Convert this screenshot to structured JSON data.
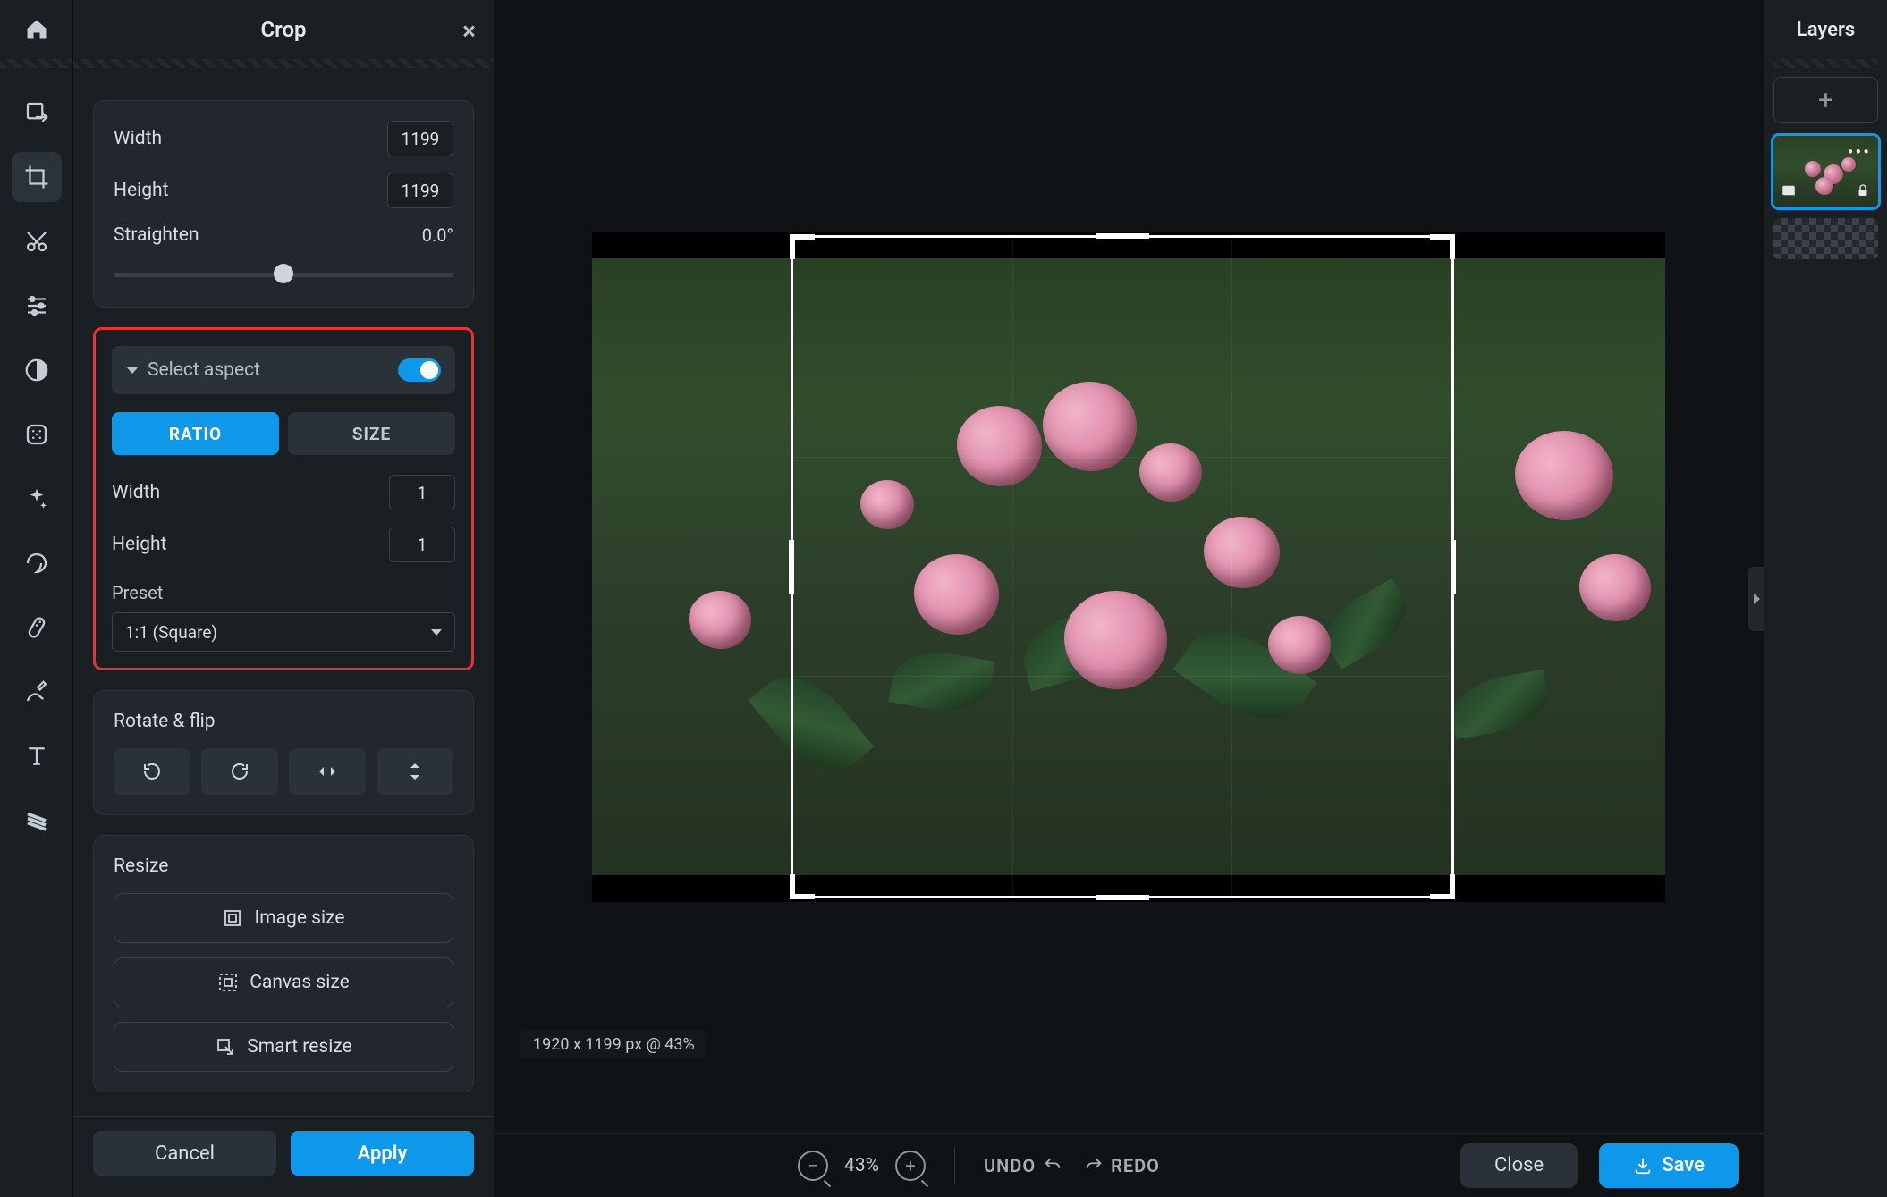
{
  "panel": {
    "title": "Crop",
    "width_label": "Width",
    "height_label": "Height",
    "straighten_label": "Straighten",
    "width_value": "1199",
    "height_value": "1199",
    "straighten_value": "0.0°",
    "aspect_heading": "Select aspect",
    "seg_ratio": "RATIO",
    "seg_size": "SIZE",
    "ratio_width_label": "Width",
    "ratio_height_label": "Height",
    "ratio_width_value": "1",
    "ratio_height_value": "1",
    "preset_label": "Preset",
    "preset_selected": "1:1 (Square)",
    "rotate_flip_title": "Rotate & flip",
    "resize_title": "Resize",
    "image_size_btn": "Image size",
    "canvas_size_btn": "Canvas size",
    "smart_resize_btn": "Smart resize",
    "cancel": "Cancel",
    "apply": "Apply"
  },
  "stage": {
    "dimensions_badge": "1920 x 1199 px @ 43%",
    "zoom": "43%",
    "undo": "UNDO",
    "redo": "REDO",
    "close": "Close",
    "save": "Save"
  },
  "layers": {
    "title": "Layers"
  }
}
